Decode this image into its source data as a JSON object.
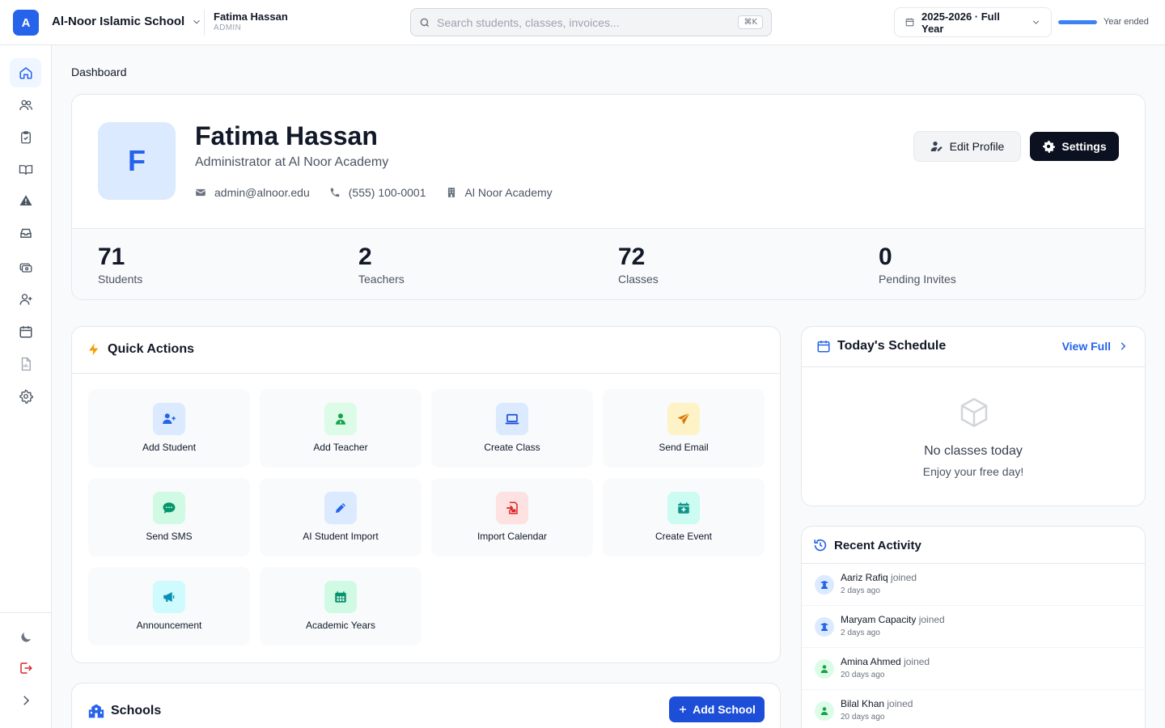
{
  "app": {
    "logo_letter": "A",
    "school_name": "Al-Noor Islamic School",
    "user_name": "Fatima Hassan",
    "user_role": "ADMIN",
    "search_placeholder": "Search students, classes, invoices...",
    "search_shortcut": "⌘K",
    "year_label": "2025-2026 · Full Year",
    "year_progress": 1.0,
    "year_status": "Year ended",
    "accent_color": "#2563eb"
  },
  "sidebar": {
    "items": [
      {
        "name": "home",
        "icon": "home-icon",
        "active": true
      },
      {
        "name": "users",
        "icon": "users-icon"
      },
      {
        "name": "attendance",
        "icon": "clipboard-check-icon"
      },
      {
        "name": "courses",
        "icon": "book-open-icon"
      },
      {
        "name": "alerts",
        "icon": "warning-icon"
      },
      {
        "name": "inbox",
        "icon": "inbox-icon"
      },
      {
        "name": "finance",
        "icon": "money-icon"
      },
      {
        "name": "invites",
        "icon": "user-plus-icon"
      },
      {
        "name": "calendar",
        "icon": "calendar-icon"
      },
      {
        "name": "reports",
        "icon": "report-icon"
      },
      {
        "name": "settings",
        "icon": "gear-icon"
      }
    ],
    "bottom": [
      {
        "name": "theme",
        "icon": "moon-icon"
      },
      {
        "name": "logout",
        "icon": "logout-icon"
      },
      {
        "name": "expand",
        "icon": "chevron-right-icon"
      }
    ]
  },
  "breadcrumb": "Dashboard",
  "profile": {
    "initial": "F",
    "name": "Fatima Hassan",
    "role": "Administrator at Al Noor Academy",
    "email": "admin@alnoor.edu",
    "phone": "(555) 100-0001",
    "organization": "Al Noor Academy",
    "edit_label": "Edit Profile",
    "settings_label": "Settings"
  },
  "stats": [
    {
      "value": "71",
      "label": "Students"
    },
    {
      "value": "2",
      "label": "Teachers"
    },
    {
      "value": "72",
      "label": "Classes"
    },
    {
      "value": "0",
      "label": "Pending Invites"
    }
  ],
  "quick_actions": {
    "title": "Quick Actions",
    "items": [
      {
        "label": "Add Student",
        "icon": "user-plus-icon",
        "bg": "#dbeafe",
        "fg": "#2563eb"
      },
      {
        "label": "Add Teacher",
        "icon": "teacher-icon",
        "bg": "#dcfce7",
        "fg": "#16a34a"
      },
      {
        "label": "Create Class",
        "icon": "laptop-icon",
        "bg": "#dbeafe",
        "fg": "#1d4ed8"
      },
      {
        "label": "Send Email",
        "icon": "paper-plane-icon",
        "bg": "#fef3c7",
        "fg": "#d97706"
      },
      {
        "label": "Send SMS",
        "icon": "sms-icon",
        "bg": "#d1fae5",
        "fg": "#059669"
      },
      {
        "label": "AI Student Import",
        "icon": "pencil-icon",
        "bg": "#dbeafe",
        "fg": "#2563eb"
      },
      {
        "label": "Import Calendar",
        "icon": "import-icon",
        "bg": "#fee2e2",
        "fg": "#dc2626"
      },
      {
        "label": "Create Event",
        "icon": "calendar-plus-icon",
        "bg": "#ccfbf1",
        "fg": "#0d9488"
      },
      {
        "label": "Announcement",
        "icon": "megaphone-icon",
        "bg": "#cffafe",
        "fg": "#0891b2"
      },
      {
        "label": "Academic Years",
        "icon": "calendar-grid-icon",
        "bg": "#d1fae5",
        "fg": "#059669"
      }
    ]
  },
  "schedule": {
    "title": "Today's Schedule",
    "view_full": "View Full",
    "empty_title": "No classes today",
    "empty_sub": "Enjoy your free day!"
  },
  "activity": {
    "title": "Recent Activity",
    "items": [
      {
        "name": "Aariz Rafiq",
        "action": "joined",
        "time": "2 days ago",
        "kind": "student"
      },
      {
        "name": "Maryam Capacity",
        "action": "joined",
        "time": "2 days ago",
        "kind": "student"
      },
      {
        "name": "Amina Ahmed",
        "action": "joined",
        "time": "20 days ago",
        "kind": "teacher"
      },
      {
        "name": "Bilal Khan",
        "action": "joined",
        "time": "20 days ago",
        "kind": "teacher"
      }
    ]
  },
  "schools": {
    "title": "Schools",
    "add_label": "Add School"
  }
}
